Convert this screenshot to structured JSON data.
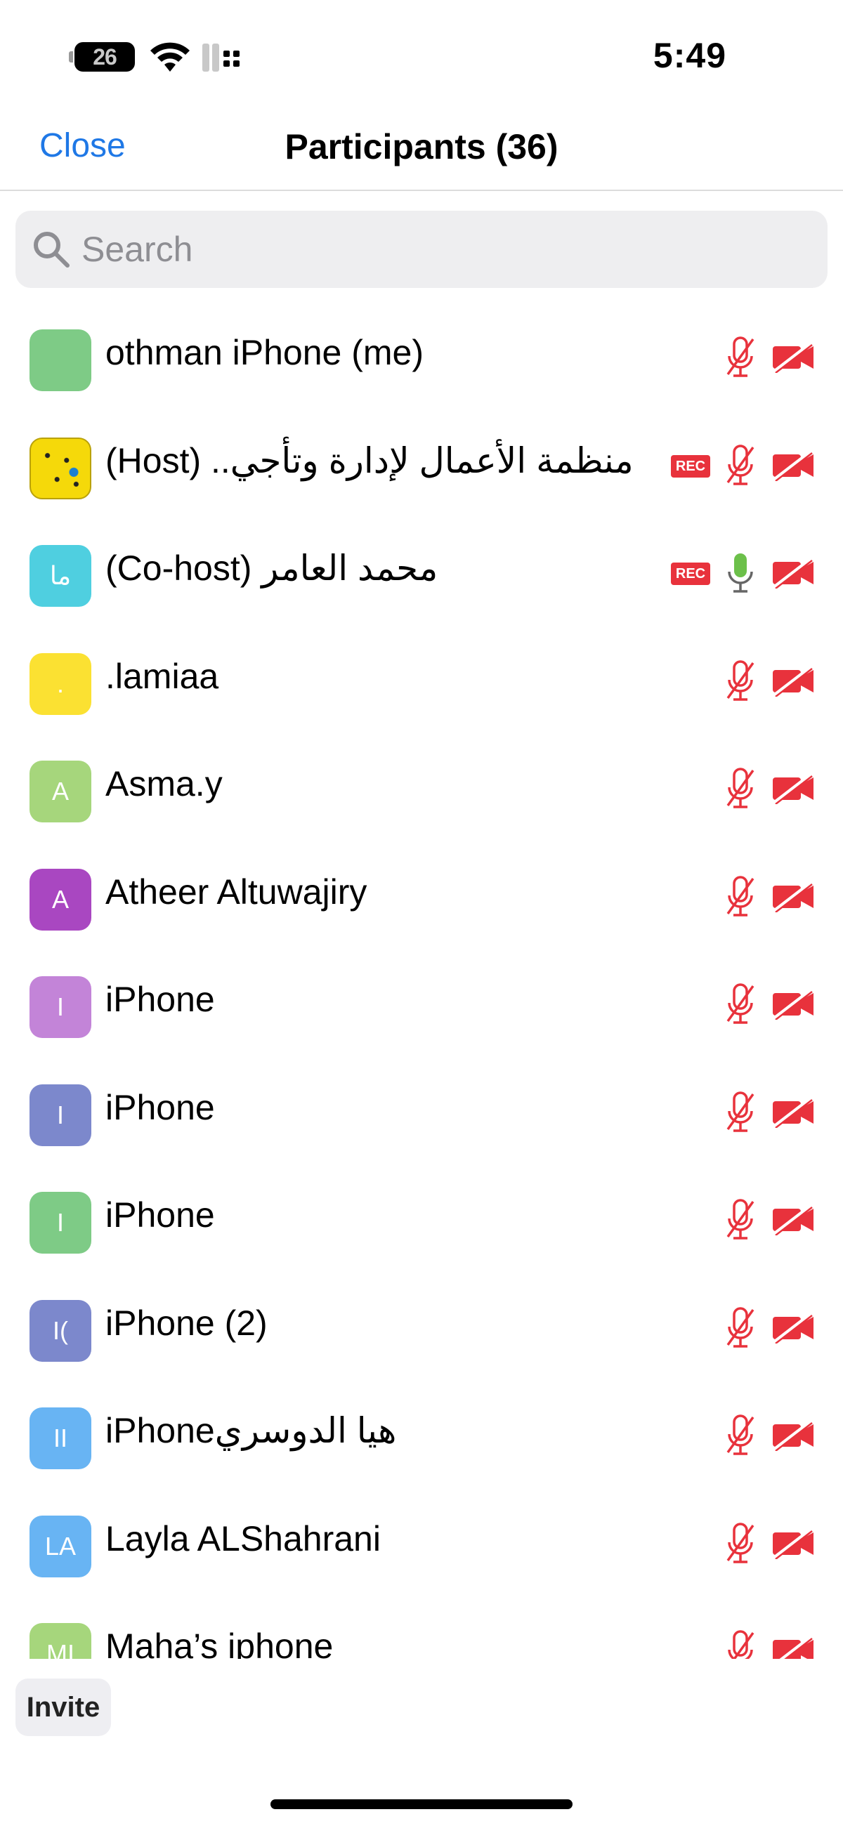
{
  "status_bar": {
    "battery": "26",
    "time": "5:49"
  },
  "nav": {
    "close_label": "Close",
    "title": "Participants (36)"
  },
  "search": {
    "placeholder": "Search"
  },
  "participants": [
    {
      "initials": "",
      "avatar_color": "#7ecb86",
      "name": "othman iPhone (me)",
      "rec": false,
      "mic": "muted",
      "video": "off"
    },
    {
      "initials": "",
      "avatar_color": "#f5d90a",
      "avatar_type": "qr-code-image",
      "name": "منظمة الأعمال لإدارة وتأجي.. (Host)",
      "rec": true,
      "rec_label": "REC",
      "mic": "muted",
      "video": "off"
    },
    {
      "initials": "ما",
      "avatar_color": "#4fcfe0",
      "name": "محمد العامر (Co-host)",
      "rec": true,
      "rec_label": "REC",
      "mic": "on",
      "video": "off"
    },
    {
      "initials": ".",
      "avatar_color": "#fbe132",
      "name": ".lamiaa",
      "rec": false,
      "mic": "muted",
      "video": "off"
    },
    {
      "initials": "A",
      "avatar_color": "#a6d67c",
      "name": "Asma.y",
      "rec": false,
      "mic": "muted",
      "video": "off"
    },
    {
      "initials": "A",
      "avatar_color": "#a947c1",
      "name": "Atheer Altuwajiry",
      "rec": false,
      "mic": "muted",
      "video": "off"
    },
    {
      "initials": "I",
      "avatar_color": "#c384d8",
      "name": "iPhone",
      "rec": false,
      "mic": "muted",
      "video": "off"
    },
    {
      "initials": "I",
      "avatar_color": "#7c88cc",
      "name": "iPhone",
      "rec": false,
      "mic": "muted",
      "video": "off"
    },
    {
      "initials": "I",
      "avatar_color": "#7ecb86",
      "name": "iPhone",
      "rec": false,
      "mic": "muted",
      "video": "off"
    },
    {
      "initials": "I(",
      "avatar_color": "#7c88cc",
      "name": "iPhone (2)",
      "rec": false,
      "mic": "muted",
      "video": "off"
    },
    {
      "initials": "II",
      "avatar_color": "#68b4f3",
      "name": "iPhoneهيا الدوسري",
      "rec": false,
      "mic": "muted",
      "video": "off"
    },
    {
      "initials": "LA",
      "avatar_color": "#68b4f3",
      "name": "Layla ALShahrani",
      "rec": false,
      "mic": "muted",
      "video": "off"
    },
    {
      "initials": "MI",
      "avatar_color": "#a6d67c",
      "name": "Maha’s iphone",
      "rec": false,
      "mic": "muted",
      "video": "off"
    }
  ],
  "footer": {
    "invite_label": "Invite"
  },
  "colors": {
    "accent": "#1f78e6",
    "muted_red": "#e8323c",
    "mic_on_green": "#6cc04a"
  }
}
